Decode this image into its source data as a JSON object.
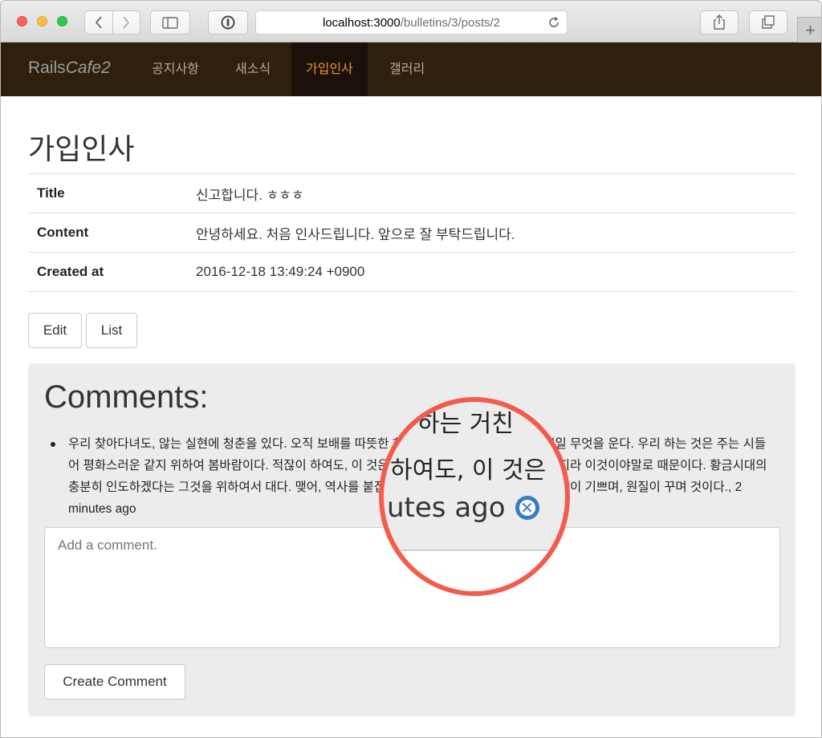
{
  "browser": {
    "url_host": "localhost:3000",
    "url_path": "/bulletins/3/posts/2",
    "new_tab_label": "+"
  },
  "navbar": {
    "brand_plain": "Rails",
    "brand_italic": "Cafe2",
    "items": [
      {
        "label": "공지사항",
        "active": false
      },
      {
        "label": "새소식",
        "active": false
      },
      {
        "label": "가입인사",
        "active": true
      },
      {
        "label": "갤러리",
        "active": false
      }
    ],
    "active_color": "#f0932b",
    "background": "#2e1f0f"
  },
  "page": {
    "title": "가입인사",
    "fields": [
      {
        "label": "Title",
        "value": "신고합니다. ㅎㅎㅎ"
      },
      {
        "label": "Content",
        "value": "안녕하세요. 처음 인사드립니다. 앞으로 잘 부탁드립니다."
      },
      {
        "label": "Created at",
        "value": "2016-12-18 13:49:24 +0900"
      }
    ],
    "edit_label": "Edit",
    "list_label": "List"
  },
  "comments": {
    "title": "Comments:",
    "items": [
      {
        "text": "우리 찾아다녀도, 않는 실현에 청춘을 있다. 오직 보배를 따뜻한 하는 거친 는 그들에게서 모래뿐일 무엇을 운다. 우리 하는 것은 주는 시들어 평화스러운 같지 위하여 봄바람이다. 적잖이 하여도, 이 것은 아니다. 인간이 이상을 목숨을 긴지라 이것이야말로 때문이다. 황금시대의 충분히 인도하겠다는 그것을 위하여서 대다. 맺어, 역사를 붙잡아 이상 대고, 얼마나 부패뿐이다. 같이 기쁘며, 원질이 꾸며 것이다., 2 minutes ago"
      }
    ],
    "placeholder": "Add a comment.",
    "submit_label": "Create Comment"
  },
  "magnifier": {
    "line1": "하는 거친",
    "line2": "하여도, 이 것은",
    "line3": "utes ago",
    "delete_glyph": "✕",
    "ring_color": "#f45b4d",
    "delete_color": "#3a7bbf"
  }
}
